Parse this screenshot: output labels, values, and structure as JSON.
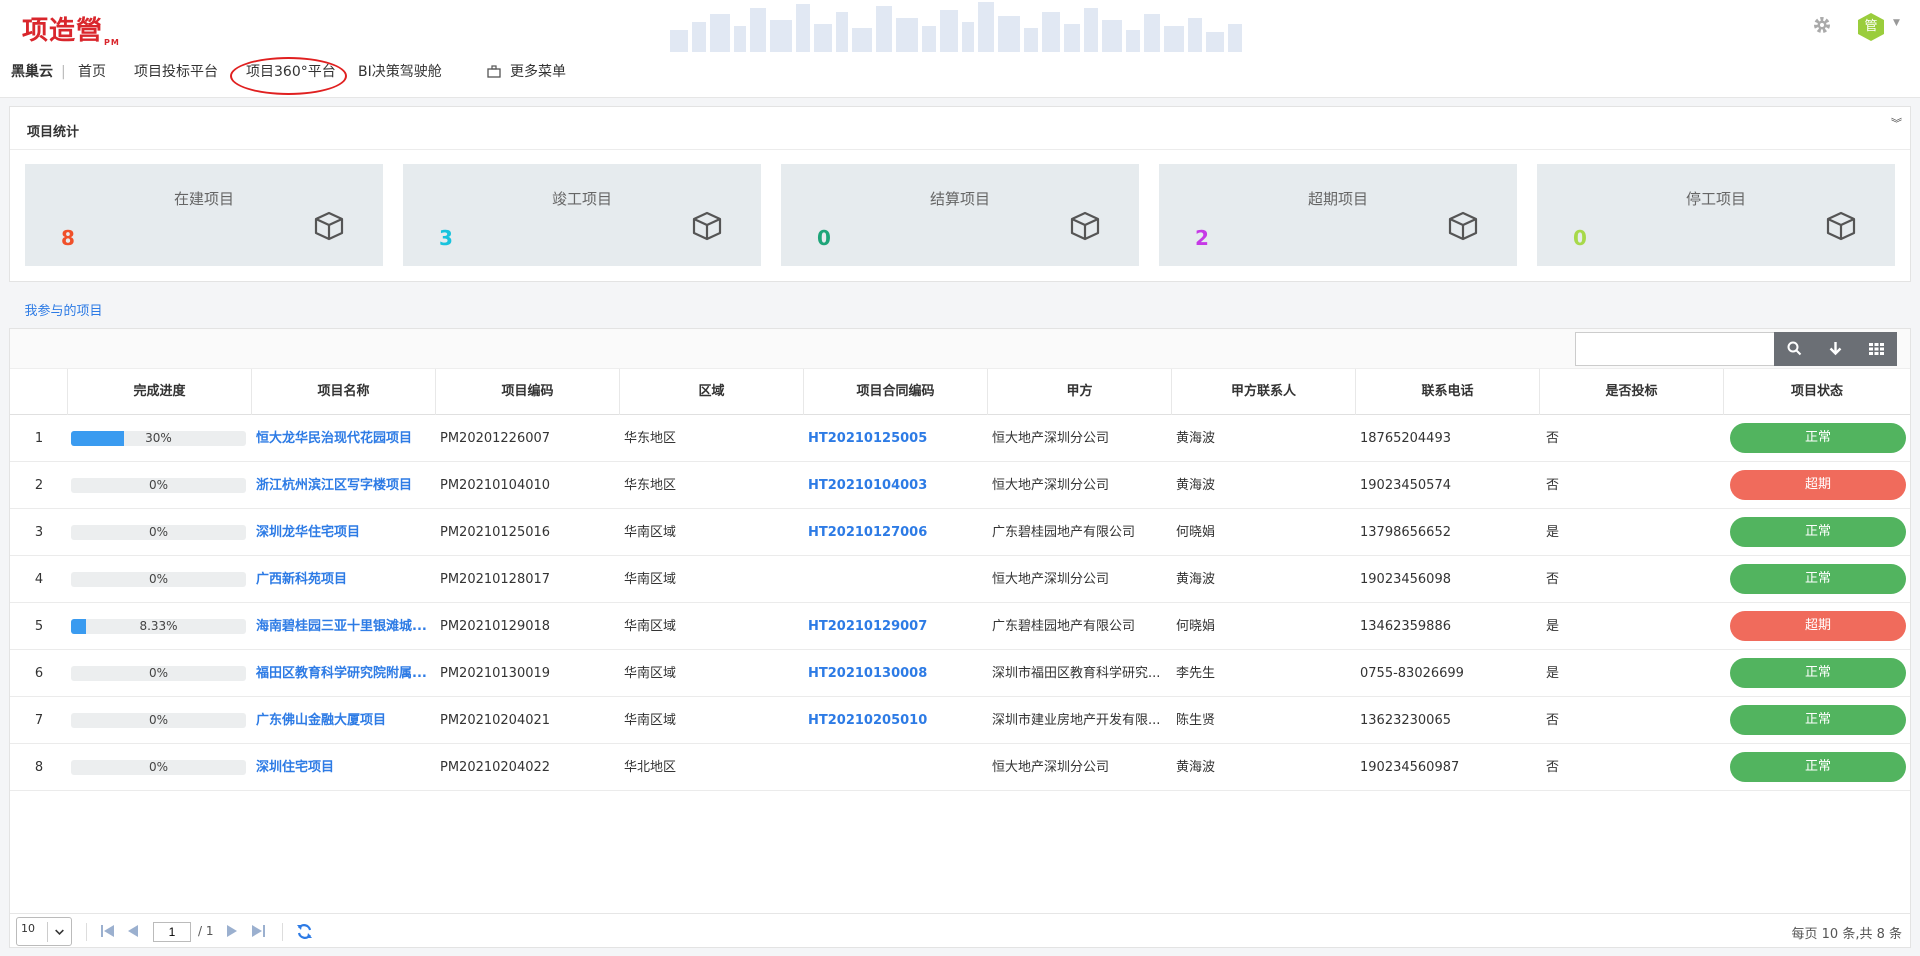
{
  "header": {
    "logo_text": "项造營",
    "logo_sub": "PM",
    "avatar_text": "管"
  },
  "nav": {
    "brand": "黑巢云",
    "items": [
      "首页",
      "项目投标平台",
      "项目360°平台",
      "BI决策驾驶舱"
    ],
    "more_menu": "更多菜单"
  },
  "stats": {
    "title": "项目统计",
    "cards": [
      {
        "label": "在建项目",
        "value": "8",
        "color": "#f0502a"
      },
      {
        "label": "竣工项目",
        "value": "3",
        "color": "#18c3dd"
      },
      {
        "label": "结算项目",
        "value": "0",
        "color": "#1ea579"
      },
      {
        "label": "超期项目",
        "value": "2",
        "color": "#c639e6"
      },
      {
        "label": "停工项目",
        "value": "0",
        "color": "#a7d94a"
      }
    ]
  },
  "tab": {
    "label": "我参与的项目"
  },
  "table": {
    "columns": [
      "完成进度",
      "项目名称",
      "项目编码",
      "区域",
      "项目合同编码",
      "甲方",
      "甲方联系人",
      "联系电话",
      "是否投标",
      "项目状态"
    ],
    "rows": [
      {
        "idx": "1",
        "progress": 30,
        "progress_text": "30%",
        "name": "恒大龙华民治现代花园项目",
        "code": "PM20201226007",
        "region": "华东地区",
        "contract": "HT20210125005",
        "party": "恒大地产深圳分公司",
        "contact": "黄海波",
        "phone": "18765204493",
        "bid": "否",
        "status": "正常",
        "status_color": "#52b45f"
      },
      {
        "idx": "2",
        "progress": 0,
        "progress_text": "0%",
        "name": "浙江杭州滨江区写字楼项目",
        "code": "PM20210104010",
        "region": "华东地区",
        "contract": "HT20210104003",
        "party": "恒大地产深圳分公司",
        "contact": "黄海波",
        "phone": "19023450574",
        "bid": "否",
        "status": "超期",
        "status_color": "#f06b5c"
      },
      {
        "idx": "3",
        "progress": 0,
        "progress_text": "0%",
        "name": "深圳龙华住宅项目",
        "code": "PM20210125016",
        "region": "华南区域",
        "contract": "HT20210127006",
        "party": "广东碧桂园地产有限公司",
        "contact": "何晓娟",
        "phone": "13798656652",
        "bid": "是",
        "status": "正常",
        "status_color": "#52b45f"
      },
      {
        "idx": "4",
        "progress": 0,
        "progress_text": "0%",
        "name": "广西新科苑项目",
        "code": "PM20210128017",
        "region": "华南区域",
        "contract": "",
        "party": "恒大地产深圳分公司",
        "contact": "黄海波",
        "phone": "19023456098",
        "bid": "否",
        "status": "正常",
        "status_color": "#52b45f"
      },
      {
        "idx": "5",
        "progress": 8.33,
        "progress_text": "8.33%",
        "name": "海南碧桂园三亚十里银滩城...",
        "code": "PM20210129018",
        "region": "华南区域",
        "contract": "HT20210129007",
        "party": "广东碧桂园地产有限公司",
        "contact": "何晓娟",
        "phone": "13462359886",
        "bid": "是",
        "status": "超期",
        "status_color": "#f06b5c"
      },
      {
        "idx": "6",
        "progress": 0,
        "progress_text": "0%",
        "name": "福田区教育科学研究院附属...",
        "code": "PM20210130019",
        "region": "华南区域",
        "contract": "HT20210130008",
        "party": "深圳市福田区教育科学研究...",
        "contact": "李先生",
        "phone": "0755-83026699",
        "bid": "是",
        "status": "正常",
        "status_color": "#52b45f"
      },
      {
        "idx": "7",
        "progress": 0,
        "progress_text": "0%",
        "name": "广东佛山金融大厦项目",
        "code": "PM20210204021",
        "region": "华南区域",
        "contract": "HT20210205010",
        "party": "深圳市建业房地产开发有限...",
        "contact": "陈生贤",
        "phone": "13623230065",
        "bid": "否",
        "status": "正常",
        "status_color": "#52b45f"
      },
      {
        "idx": "8",
        "progress": 0,
        "progress_text": "0%",
        "name": "深圳住宅项目",
        "code": "PM20210204022",
        "region": "华北地区",
        "contract": "",
        "party": "恒大地产深圳分公司",
        "contact": "黄海波",
        "phone": "190234560987",
        "bid": "否",
        "status": "正常",
        "status_color": "#52b45f"
      }
    ]
  },
  "pager": {
    "page_size": "10",
    "current_page": "1",
    "total_pages": "/ 1",
    "summary": "每页 10 条,共 8 条"
  }
}
